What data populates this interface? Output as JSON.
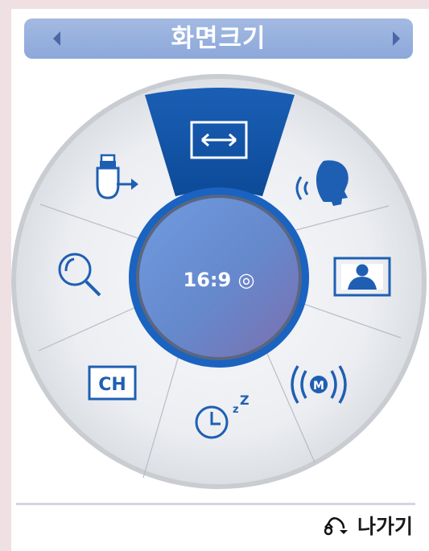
{
  "header": {
    "title": "화면크기"
  },
  "dial": {
    "center_value": "16:9 ◎",
    "items": [
      {
        "name": "picture-size",
        "icon": "picture-size-icon",
        "selected": true
      },
      {
        "name": "sound-mode",
        "icon": "speaking-head-icon",
        "selected": false
      },
      {
        "name": "picture-mode",
        "icon": "person-picture-icon",
        "selected": false
      },
      {
        "name": "mts",
        "icon": "mts-sound-icon",
        "label": "M",
        "selected": false
      },
      {
        "name": "sleep-timer",
        "icon": "sleep-timer-icon",
        "label": "ZZ",
        "selected": false
      },
      {
        "name": "channel",
        "icon": "channel-icon",
        "label": "CH",
        "selected": false
      },
      {
        "name": "zoom",
        "icon": "magnifier-icon",
        "selected": false
      },
      {
        "name": "input-source",
        "icon": "input-source-icon",
        "selected": false
      }
    ]
  },
  "footer": {
    "exit_label": "나가기",
    "exit_icon": "return-arrow-icon"
  },
  "colors": {
    "title_bar": "#96afdd",
    "accent_blue": "#1a62b8",
    "dial_rim": "#c8cbd0",
    "dial_face": "#e8eaee",
    "icon_blue": "#1f5fb3"
  }
}
